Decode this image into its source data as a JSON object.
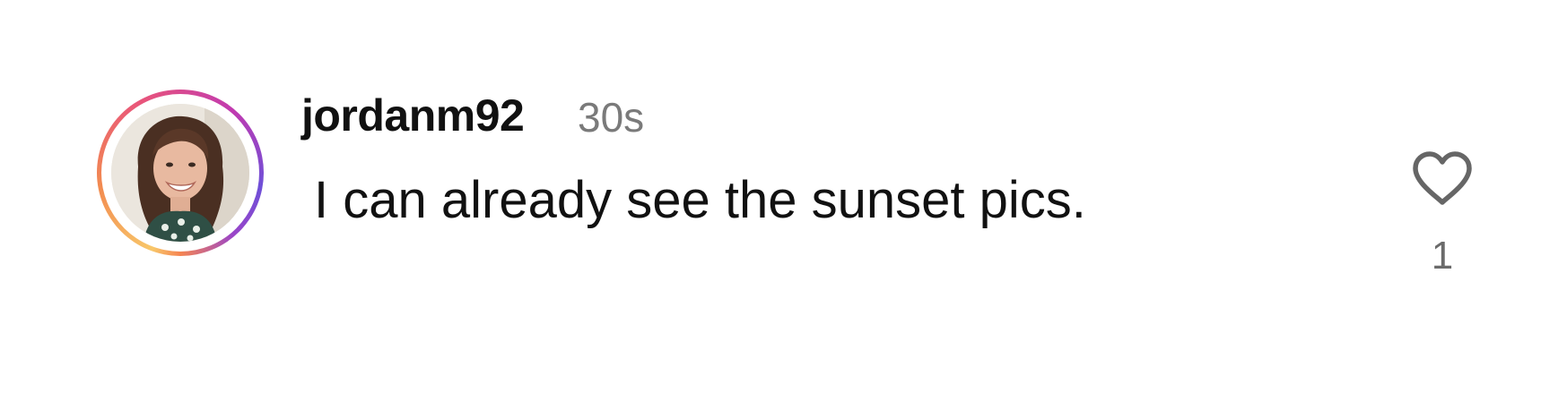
{
  "comment": {
    "username": "jordanm92",
    "time_ago": "30s",
    "text": "I can already see the sunset pics.",
    "like_count": "1",
    "liked": false
  },
  "colors": {
    "username": "#111111",
    "timestamp": "#7a7a7a",
    "text": "#111111",
    "like_icon": "#666666",
    "like_count": "#6b6b6b",
    "story_ring": [
      "#6e4fd8",
      "#c13ab0",
      "#e9557a",
      "#f28b50",
      "#f8c76a"
    ]
  },
  "icons": {
    "avatar": "user-avatar-photo",
    "like": "heart-outline-icon"
  }
}
